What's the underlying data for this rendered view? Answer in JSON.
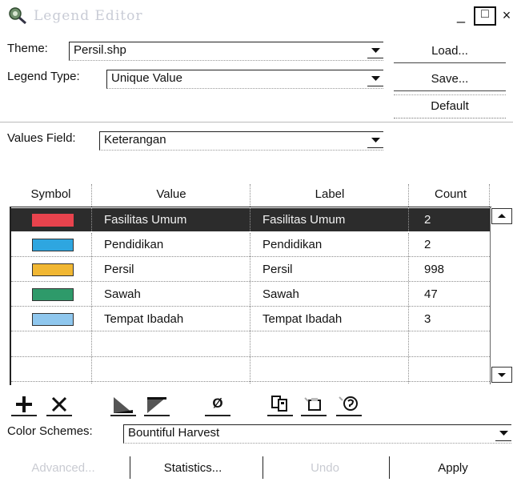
{
  "window": {
    "title": "Legend Editor",
    "controls": {
      "minimize": "_",
      "maximize": "□",
      "close": "×"
    }
  },
  "theme": {
    "label": "Theme:",
    "value": "Persil.shp"
  },
  "legend_type": {
    "label": "Legend Type:",
    "value": "Unique Value"
  },
  "side_buttons": {
    "load": "Load...",
    "save": "Save...",
    "default": "Default"
  },
  "values_field": {
    "label": "Values Field:",
    "value": "Keterangan"
  },
  "table": {
    "columns": [
      "Symbol",
      "Value",
      "Label",
      "Count"
    ],
    "rows": [
      {
        "color": "#e8434d",
        "value": "Fasilitas Umum",
        "label": "Fasilitas Umum",
        "count": "2",
        "selected": true
      },
      {
        "color": "#2ea6e0",
        "value": "Pendidikan",
        "label": "Pendidikan",
        "count": "2",
        "selected": false
      },
      {
        "color": "#f1b733",
        "value": "Persil",
        "label": "Persil",
        "count": "998",
        "selected": false
      },
      {
        "color": "#2e9a6a",
        "value": "Sawah",
        "label": "Sawah",
        "count": "47",
        "selected": false
      },
      {
        "color": "#8fc7ee",
        "value": "Tempat Ibadah",
        "label": "Tempat Ibadah",
        "count": "3",
        "selected": false
      }
    ]
  },
  "toolbar_icons": [
    "add-icon",
    "delete-icon",
    "sort-ascending-icon",
    "sort-descending-icon",
    "null-value-icon",
    "copy-symbols-icon",
    "paste-symbols-icon",
    "symbol-properties-icon"
  ],
  "toolbar_text": {
    "null": "Ø"
  },
  "color_schemes": {
    "label": "Color Schemes:",
    "value": "Bountiful Harvest"
  },
  "bottom_buttons": {
    "advanced": "Advanced...",
    "statistics": "Statistics...",
    "undo": "Undo",
    "apply": "Apply"
  }
}
